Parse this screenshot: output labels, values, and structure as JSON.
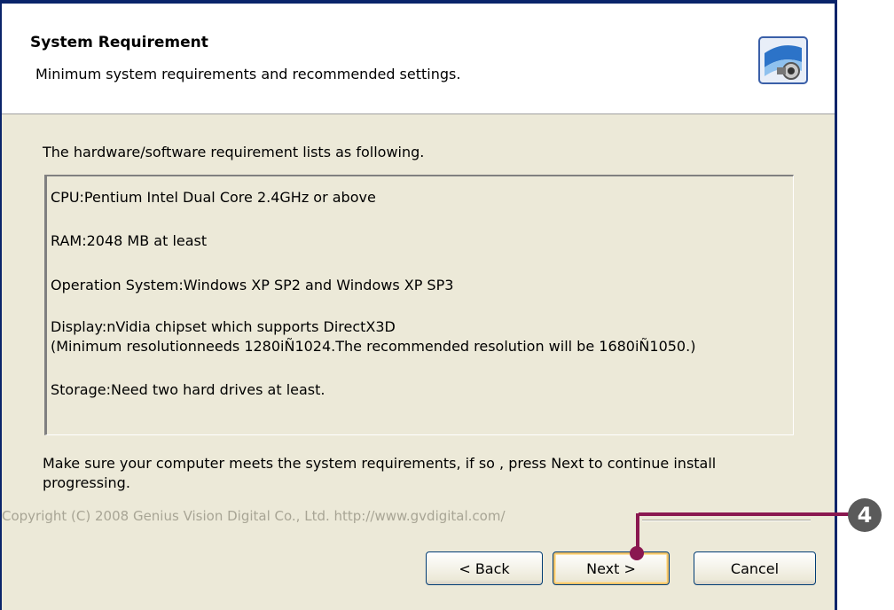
{
  "header": {
    "title": "System Requirement",
    "subtitle": "Minimum system requirements and recommended settings."
  },
  "intro": "The hardware/software requirement lists as following.",
  "requirements": [
    "CPU:Pentium Intel Dual Core 2.4GHz or above",
    "RAM:2048 MB at least",
    "Operation System:Windows XP SP2 and Windows XP SP3",
    "Display:nVidia chipset which supports DirectX3D",
    "(Minimum resolutionneeds 1280iÑ1024.The recommended resolution will be 1680iÑ1050.)",
    "Storage:Need two hard drives at least."
  ],
  "footer_text": "Make sure your computer meets the system requirements, if so , press Next to continue install progressing.",
  "copyright": "Copyright (C) 2008 Genius Vision Digital Co., Ltd. http://www.gvdigital.com/",
  "buttons": {
    "back": "< Back",
    "next": "Next >",
    "cancel": "Cancel"
  },
  "callout": {
    "number": "4"
  },
  "colors": {
    "titlebar": "#0a246a",
    "dialog_bg": "#ece9d8",
    "callout": "#8a1850"
  },
  "icons": {
    "header": "setup-camera-icon"
  }
}
